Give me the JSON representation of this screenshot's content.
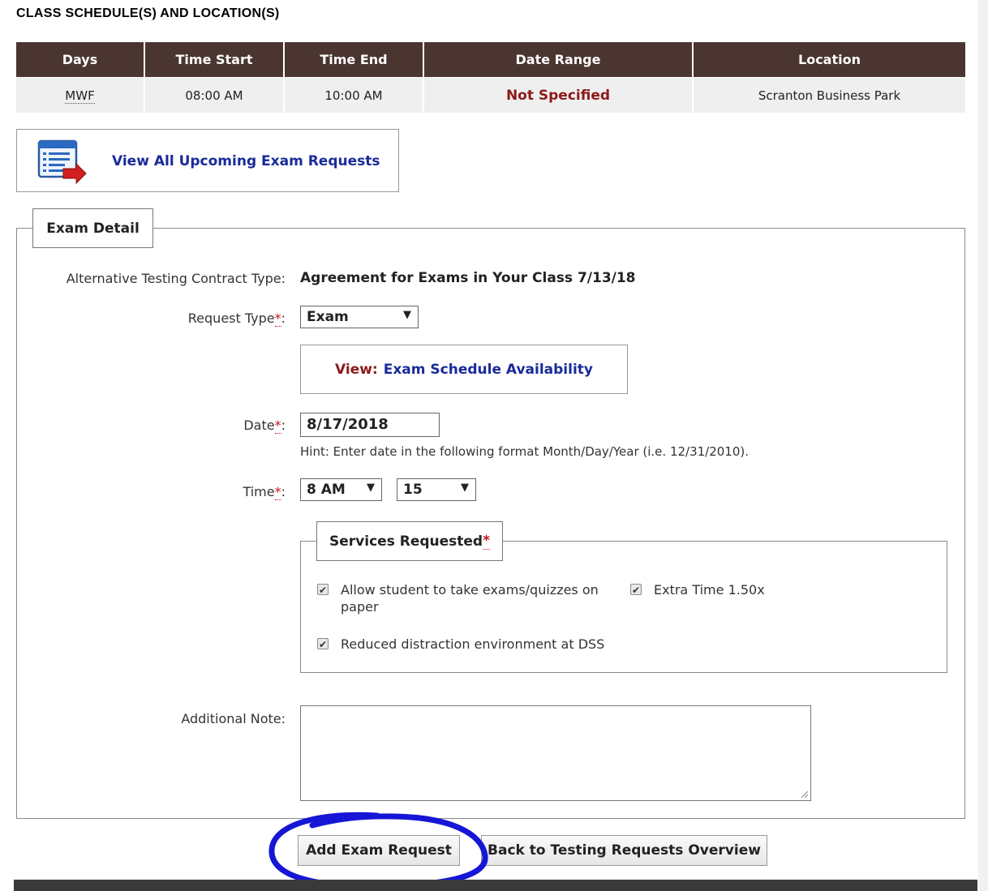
{
  "schedule": {
    "title": "CLASS SCHEDULE(S) AND LOCATION(S)",
    "headers": [
      "Days",
      "Time Start",
      "Time End",
      "Date Range",
      "Location"
    ],
    "row": {
      "days": "MWF",
      "time_start": "08:00 AM",
      "time_end": "10:00 AM",
      "date_range": "Not Specified",
      "location": "Scranton Business Park"
    }
  },
  "upcoming": {
    "link_label": "View All Upcoming Exam Requests",
    "icon": "calendar-list-arrow-icon"
  },
  "exam_detail": {
    "legend": "Exam Detail",
    "contract_type_label": "Alternative Testing Contract Type:",
    "contract_type_value": "Agreement for Exams in Your Class 7/13/18",
    "request_type_label": "Request Type",
    "request_type_value": "Exam",
    "view_word": "View:",
    "availability_link": "Exam Schedule Availability",
    "date_label": "Date",
    "date_value": "8/17/2018",
    "date_hint": "Hint: Enter date in the following format Month/Day/Year (i.e. 12/31/2010).",
    "time_label": "Time",
    "time_hour": "8 AM",
    "time_minute": "15",
    "required_mark": "*",
    "colon": ":",
    "services": {
      "legend": "Services Requested",
      "items": [
        {
          "label": "Allow student to take exams/quizzes on paper",
          "checked": true
        },
        {
          "label": "Extra Time 1.50x",
          "checked": true
        },
        {
          "label": "Reduced distraction environment at DSS",
          "checked": true
        }
      ]
    },
    "note_label": "Additional Note:",
    "note_value": ""
  },
  "actions": {
    "add_label": "Add Exam Request",
    "back_label": "Back to Testing Requests Overview"
  },
  "colors": {
    "header_bg": "#4a3530",
    "link_blue": "#1a2a9a",
    "accent_red": "#8b1a1a",
    "annotation_blue": "#1616d6"
  }
}
